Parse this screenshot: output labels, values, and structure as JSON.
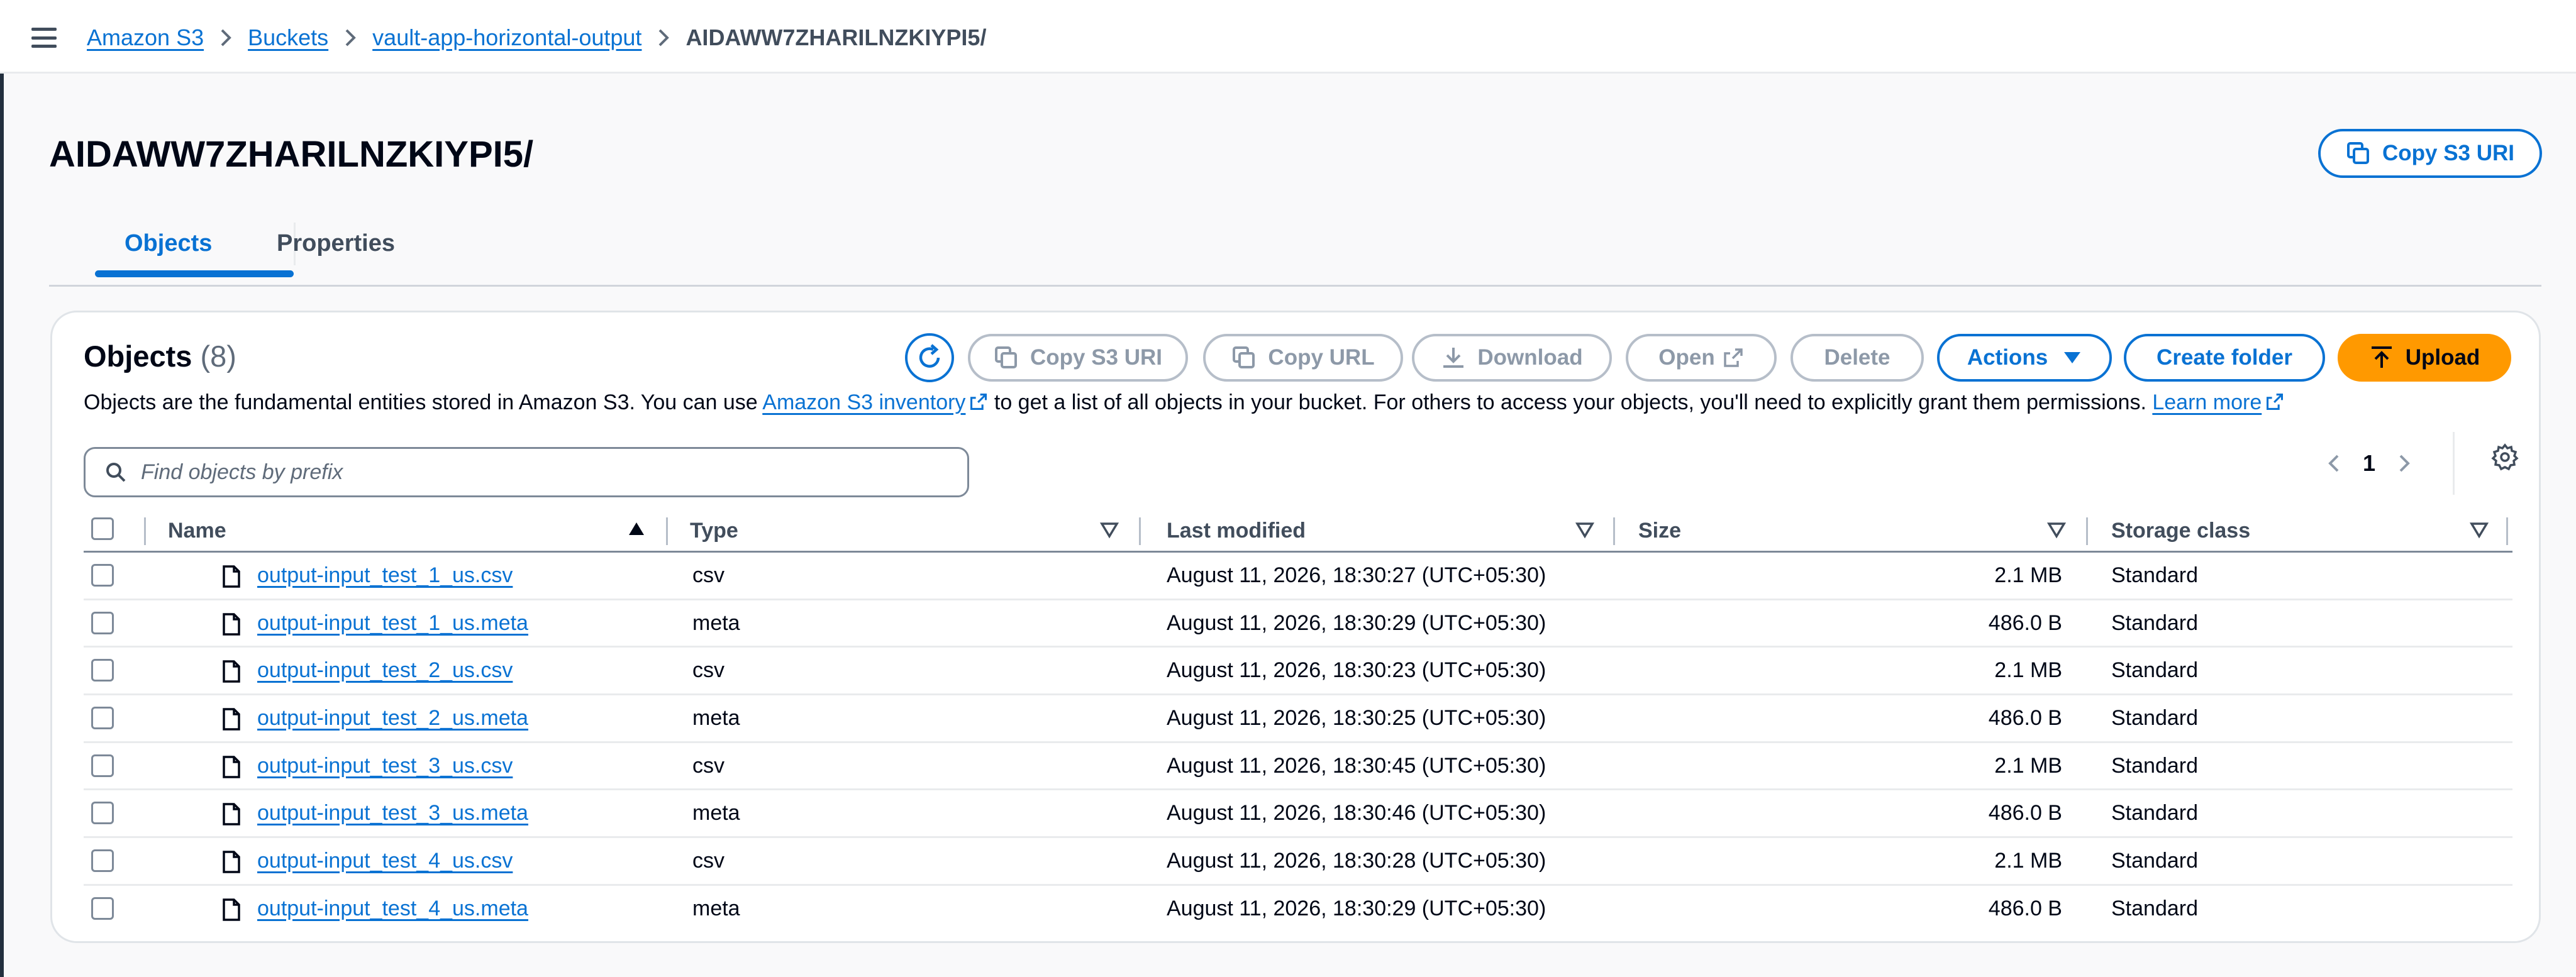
{
  "breadcrumb": {
    "items": [
      "Amazon S3",
      "Buckets",
      "vault-app-horizontal-output"
    ],
    "current": "AIDAWW7ZHARILNZKIYPI5/"
  },
  "header": {
    "title": "AIDAWW7ZHARILNZKIYPI5/",
    "copy_uri_label": "Copy S3 URI"
  },
  "tabs": [
    {
      "label": "Objects",
      "active": true
    },
    {
      "label": "Properties",
      "active": false
    }
  ],
  "objects_panel": {
    "title": "Objects",
    "count": "(8)",
    "description_prefix": "Objects are the fundamental entities stored in Amazon S3. You can use ",
    "inventory_link": "Amazon S3 inventory",
    "description_middle": " to get a list of all objects in your bucket. For others to access your objects, you'll need to explicitly grant them permissions. ",
    "learn_more": "Learn more",
    "actions": {
      "copy_uri": "Copy S3 URI",
      "copy_url": "Copy URL",
      "download": "Download",
      "open": "Open",
      "delete": "Delete",
      "actions": "Actions",
      "create_folder": "Create folder",
      "upload": "Upload"
    },
    "search_placeholder": "Find objects by prefix",
    "page": "1"
  },
  "table": {
    "columns": [
      "Name",
      "Type",
      "Last modified",
      "Size",
      "Storage class"
    ],
    "rows": [
      {
        "name": "output-input_test_1_us.csv",
        "type": "csv",
        "modified": "August 11, 2026, 18:30:27 (UTC+05:30)",
        "size": "2.1 MB",
        "storage": "Standard"
      },
      {
        "name": "output-input_test_1_us.meta",
        "type": "meta",
        "modified": "August 11, 2026, 18:30:29 (UTC+05:30)",
        "size": "486.0 B",
        "storage": "Standard"
      },
      {
        "name": "output-input_test_2_us.csv",
        "type": "csv",
        "modified": "August 11, 2026, 18:30:23 (UTC+05:30)",
        "size": "2.1 MB",
        "storage": "Standard"
      },
      {
        "name": "output-input_test_2_us.meta",
        "type": "meta",
        "modified": "August 11, 2026, 18:30:25 (UTC+05:30)",
        "size": "486.0 B",
        "storage": "Standard"
      },
      {
        "name": "output-input_test_3_us.csv",
        "type": "csv",
        "modified": "August 11, 2026, 18:30:45 (UTC+05:30)",
        "size": "2.1 MB",
        "storage": "Standard"
      },
      {
        "name": "output-input_test_3_us.meta",
        "type": "meta",
        "modified": "August 11, 2026, 18:30:46 (UTC+05:30)",
        "size": "486.0 B",
        "storage": "Standard"
      },
      {
        "name": "output-input_test_4_us.csv",
        "type": "csv",
        "modified": "August 11, 2026, 18:30:28 (UTC+05:30)",
        "size": "2.1 MB",
        "storage": "Standard"
      },
      {
        "name": "output-input_test_4_us.meta",
        "type": "meta",
        "modified": "August 11, 2026, 18:30:29 (UTC+05:30)",
        "size": "486.0 B",
        "storage": "Standard"
      }
    ]
  },
  "colors": {
    "link": "#0972d3",
    "upload": "#ff9900",
    "disabled": "#8d99a8"
  },
  "icons": [
    "menu-icon",
    "chevron-right-icon",
    "copy-icon",
    "refresh-icon",
    "download-icon",
    "external-link-icon",
    "caret-down-icon",
    "upload-icon",
    "search-icon",
    "chevron-left-icon",
    "gear-icon",
    "sort-ascending-icon",
    "sort-icon",
    "file-icon"
  ]
}
